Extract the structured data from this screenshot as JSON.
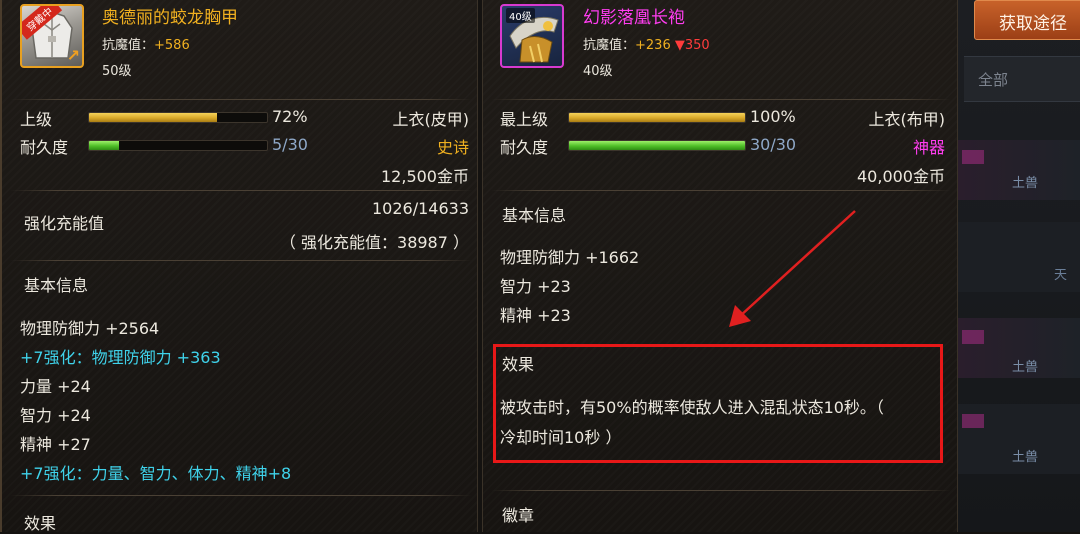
{
  "left": {
    "badge": "穿戴中",
    "item_name": "奥德丽的蛟龙胸甲",
    "magic_resist_label": "抗魔值：",
    "magic_resist_value": "+586",
    "level": "50级",
    "grade_label": "上级",
    "grade_percent": "72%",
    "grade_fill": 0.72,
    "slot": "上衣(皮甲)",
    "durability_label": "耐久度",
    "durability": "5/30",
    "durability_fill": 0.1667,
    "rarity": "史诗",
    "price": "12,500金币",
    "enhance_label": "强化充能值",
    "enhance_progress": "1026/14633",
    "enhance_note": "（ 强化充能值：38987 ）",
    "basic_info_title": "基本信息",
    "stats": [
      "物理防御力 +2564",
      "+7强化：物理防御力 +363",
      "力量 +24",
      "智力 +24",
      "精神 +27",
      "+7强化：力量、智力、体力、精神+8"
    ],
    "effect_title": "效果"
  },
  "right": {
    "level_badge": "40级",
    "item_name": "幻影落凰长袍",
    "magic_resist_label": "抗魔值：",
    "magic_resist_value": "+236",
    "magic_resist_diff": "▼350",
    "level": "40级",
    "grade_label": "最上级",
    "grade_percent": "100%",
    "grade_fill": 1.0,
    "slot": "上衣(布甲)",
    "durability_label": "耐久度",
    "durability": "30/30",
    "durability_fill": 1.0,
    "rarity": "神器",
    "price": "40,000金币",
    "basic_info_title": "基本信息",
    "stats": [
      "物理防御力 +1662",
      "智力 +23",
      "精神 +23"
    ],
    "effect_title": "效果",
    "effect_text_line1": "被攻击时，有50%的概率使敌人进入混乱状态10秒。（",
    "effect_text_line2": "冷却时间10秒 ）",
    "emblem_title": "徽章"
  },
  "side": {
    "acquire_button": "获取途径",
    "tab_all": "全部",
    "list_texts": [
      "土兽",
      "天",
      "土兽",
      "土兽"
    ]
  },
  "colors": {
    "epic_name": "#f0b020",
    "divine_name": "#ff3df0",
    "resist_value": "#f0b020",
    "resist_down": "#ff3b3b",
    "epic": "#f0b020",
    "divine": "#ff3df0",
    "highlight_box": "#e81818",
    "arrow": "#e02020"
  }
}
